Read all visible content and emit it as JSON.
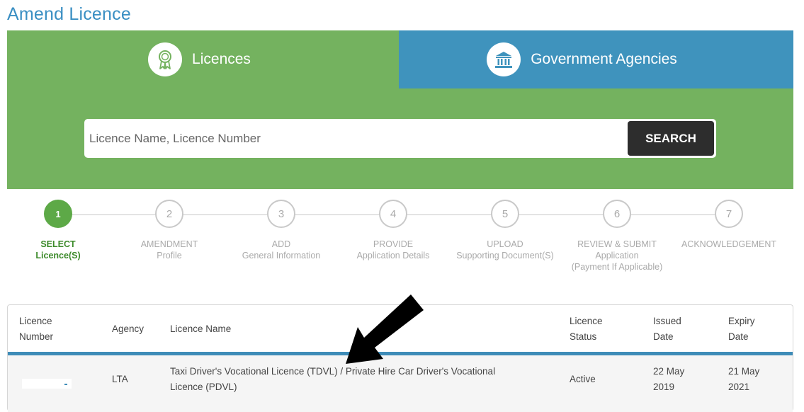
{
  "page": {
    "title": "Amend Licence"
  },
  "tabs": [
    {
      "label": "Licences",
      "icon": "ribbon-award-icon"
    },
    {
      "label": "Government Agencies",
      "icon": "government-building-icon"
    }
  ],
  "search": {
    "placeholder": "Licence Name, Licence Number",
    "button_label": "SEARCH"
  },
  "steps": [
    {
      "number": "1",
      "line1": "SELECT",
      "line2": "Licence(S)",
      "line3": "",
      "active": true
    },
    {
      "number": "2",
      "line1": "AMENDMENT",
      "line2": "Profile",
      "line3": "",
      "active": false
    },
    {
      "number": "3",
      "line1": "ADD",
      "line2": "General Information",
      "line3": "",
      "active": false
    },
    {
      "number": "4",
      "line1": "PROVIDE",
      "line2": "Application Details",
      "line3": "",
      "active": false
    },
    {
      "number": "5",
      "line1": "UPLOAD",
      "line2": "Supporting Document(S)",
      "line3": "",
      "active": false
    },
    {
      "number": "6",
      "line1": "REVIEW & SUBMIT",
      "line2": "Application",
      "line3": "(Payment If Applicable)",
      "active": false
    },
    {
      "number": "7",
      "line1": "ACKNOWLEDGEMENT",
      "line2": "",
      "line3": "",
      "active": false
    }
  ],
  "table": {
    "headers": {
      "licence_number": [
        "Licence",
        "Number"
      ],
      "agency": "Agency",
      "licence_name": "Licence Name",
      "licence_status": [
        "Licence",
        "Status"
      ],
      "issued_date": [
        "Issued",
        "Date"
      ],
      "expiry_date": [
        "Expiry",
        "Date"
      ]
    },
    "rows": [
      {
        "licence_number": "",
        "agency": "LTA",
        "licence_name": [
          "Taxi Driver's Vocational Licence (TDVL) / Private Hire Car Driver's Vocational",
          "Licence (PDVL)"
        ],
        "licence_status": "Active",
        "issued_date": [
          "22 May",
          "2019"
        ],
        "expiry_date": [
          "21 May",
          "2021"
        ]
      }
    ]
  },
  "colors": {
    "green": "#74b25f",
    "blue": "#3f93bd",
    "title_blue": "#3a8fc3",
    "active_step": "#5da947",
    "dark_button": "#2d2d2d"
  },
  "annotation": {
    "icon": "black-arrow-pointer-icon"
  }
}
